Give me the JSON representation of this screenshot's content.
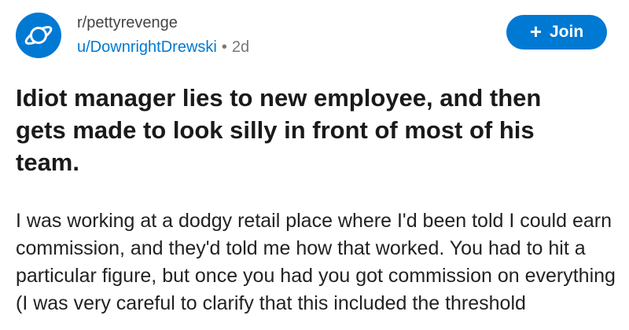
{
  "post": {
    "subreddit": "r/pettyrevenge",
    "author": "u/DownrightDrewski",
    "separator": "•",
    "age": "2d",
    "join_label": "Join",
    "join_icon": "+",
    "title": "Idiot manager lies to new employee, and then gets made to look silly in front of most of his team.",
    "body": "I was working at a dodgy retail place where I'd been told I could earn commission, and they'd told me how that worked. You had to hit a particular figure, but once you had you got commission on everything (I was very careful to clarify that this included the threshold"
  },
  "colors": {
    "accent": "#0079d3",
    "text": "#1a1a1b",
    "muted": "#777777"
  },
  "icons": {
    "avatar": "planet-icon",
    "join": "plus-icon"
  }
}
